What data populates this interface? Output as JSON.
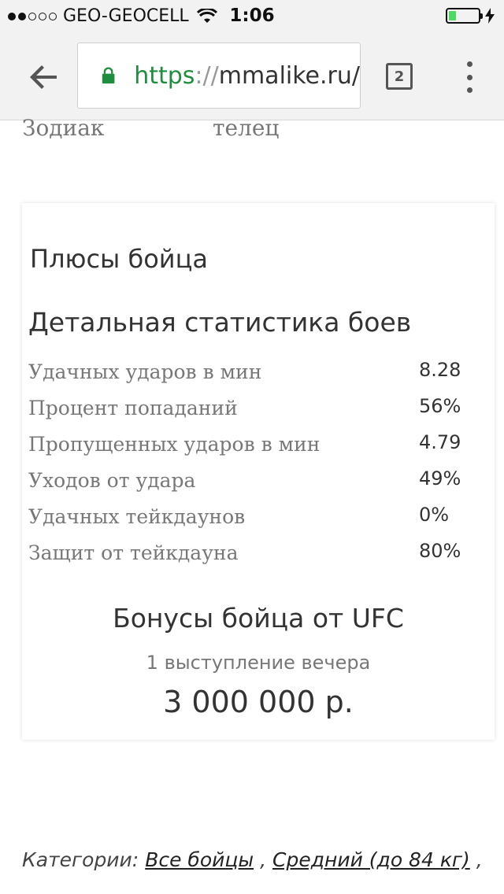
{
  "status_bar": {
    "carrier": "GEO-GEOCELL",
    "time": "1:06",
    "signal_strength": 2,
    "signal_max": 5,
    "battery_color": "#4cd964",
    "battery_level": 0.25
  },
  "browser": {
    "url_scheme": "https",
    "url_sep": "://",
    "url_host": "mmalike.ru/",
    "tab_count": "2",
    "lock_color": "#1e8e3e",
    "icons": {
      "back": "arrow-back-icon",
      "lock": "lock-icon",
      "tabs": "tabs-icon",
      "menu": "more-vert-icon"
    }
  },
  "profile": {
    "zodiac_label": "Зодиак",
    "zodiac_value": "телец"
  },
  "card": {
    "pluses_title": "Плюсы бойца",
    "stats_title": "Детальная статистика боев",
    "stats": [
      {
        "label": "Удачных ударов в мин",
        "value": "8.28"
      },
      {
        "label": "Процент попаданий",
        "value": "56%"
      },
      {
        "label": "Пропущенных ударов в мин",
        "value": "4.79"
      },
      {
        "label": "Уходов от удара",
        "value": "49%"
      },
      {
        "label": "Удачных тейкдаунов",
        "value": "0%"
      },
      {
        "label": "Защит от тейкдауна",
        "value": "80%"
      }
    ],
    "bonus_title": "Бонусы бойца от UFC",
    "bonus_subtitle": "1 выступление вечера",
    "bonus_amount": "3 000 000 р."
  },
  "categories": {
    "label": "Категории:",
    "links": [
      "Все бойцы",
      "Средний (до 84 кг)"
    ],
    "separator": ",",
    "trailing": ","
  }
}
